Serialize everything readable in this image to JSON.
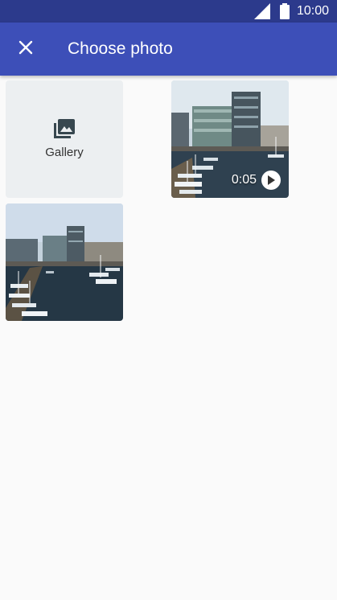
{
  "status_bar": {
    "time": "10:00",
    "signal_icon": "signal-icon",
    "battery_icon": "battery-icon"
  },
  "app_bar": {
    "title": "Choose photo",
    "close_icon": "close-icon"
  },
  "grid": {
    "gallery": {
      "label": "Gallery",
      "icon": "photo-library-icon"
    },
    "items": [
      {
        "type": "video",
        "duration": "0:05"
      },
      {
        "type": "photo"
      }
    ]
  },
  "colors": {
    "app_bar": "#3d4fb8",
    "status_bar": "#2c3a8c",
    "background": "#fafafa",
    "gallery_tile": "#eceff1"
  }
}
